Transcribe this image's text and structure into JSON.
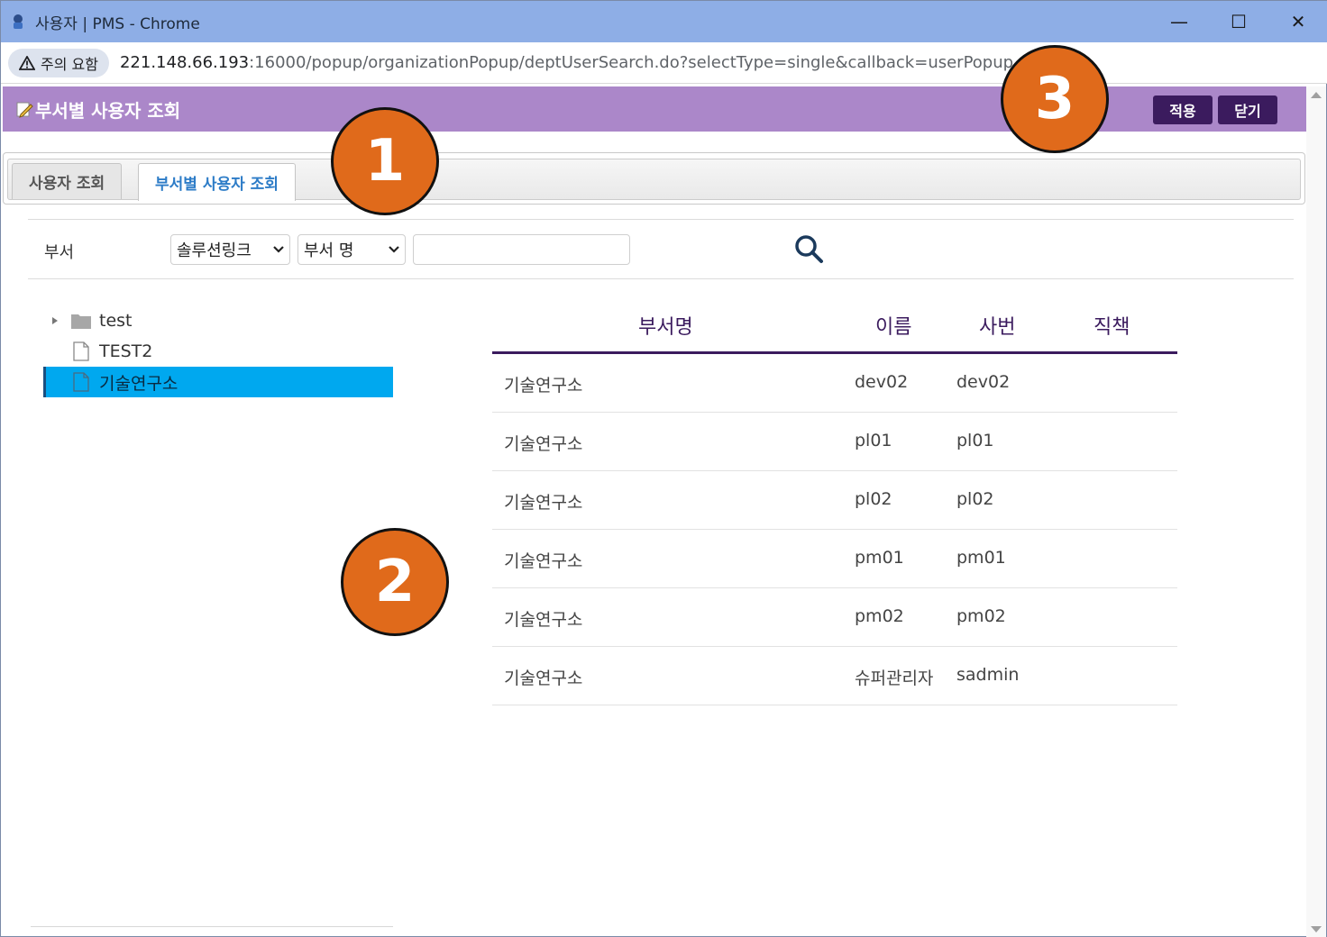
{
  "window": {
    "title": "사용자 | PMS - Chrome",
    "controls": {
      "minimize": "—",
      "maximize": "☐",
      "close": "✕"
    }
  },
  "addressbar": {
    "warning": "주의 요함",
    "url_host": "221.148.66.193",
    "url_rest": ":16000/popup/organizationPopup/deptUserSearch.do?selectType=single&callback=userPopup..."
  },
  "popup": {
    "title": "부서별 사용자 조회",
    "apply_label": "적용",
    "close_label": "닫기"
  },
  "tabs": [
    {
      "label": "사용자 조회",
      "active": false
    },
    {
      "label": "부서별 사용자 조회",
      "active": true
    }
  ],
  "search": {
    "label": "부서",
    "company_select": "솔루션링크",
    "field_select": "부서 명",
    "input_value": ""
  },
  "tree": [
    {
      "label": "test",
      "type": "folder",
      "selected": false
    },
    {
      "label": "TEST2",
      "type": "file",
      "selected": false
    },
    {
      "label": "기술연구소",
      "type": "file",
      "selected": true
    }
  ],
  "table": {
    "columns": [
      "부서명",
      "이름",
      "사번",
      "직책"
    ],
    "rows": [
      [
        "기술연구소",
        "dev02",
        "dev02",
        ""
      ],
      [
        "기술연구소",
        "pl01",
        "pl01",
        ""
      ],
      [
        "기술연구소",
        "pl02",
        "pl02",
        ""
      ],
      [
        "기술연구소",
        "pm01",
        "pm01",
        ""
      ],
      [
        "기술연구소",
        "pm02",
        "pm02",
        ""
      ],
      [
        "기술연구소",
        "슈퍼관리자",
        "sadmin",
        ""
      ]
    ]
  },
  "markers": [
    "1",
    "2",
    "3"
  ],
  "colors": {
    "header_purple": "#ab87c9",
    "button_dark": "#3b1b5e",
    "selected_node": "#00a8ef",
    "marker_orange": "#e06a1b"
  }
}
